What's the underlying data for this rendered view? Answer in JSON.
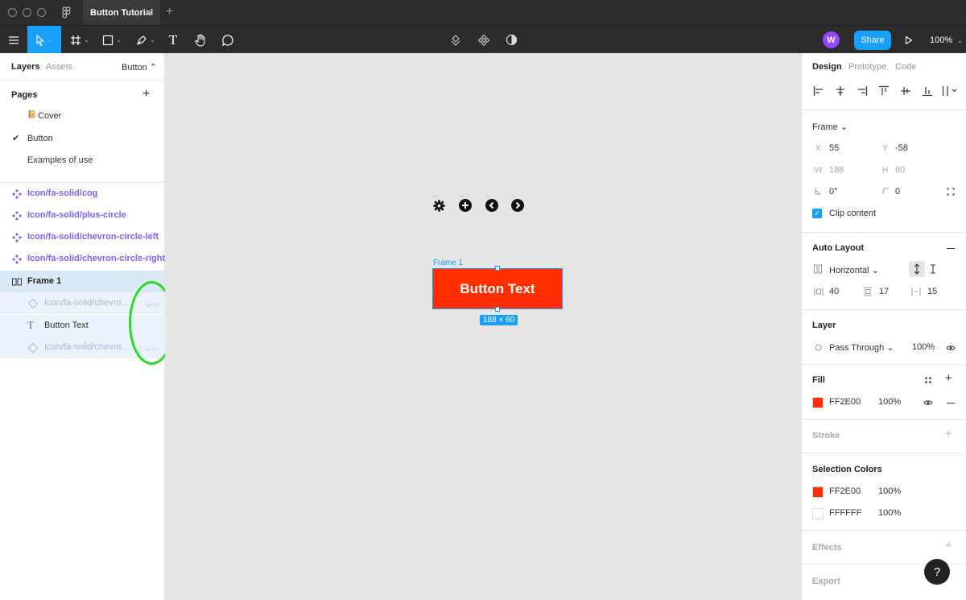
{
  "titlebar": {
    "tab_title": "Button Tutorial",
    "tab_close": "✕",
    "tab_add": "+"
  },
  "toolbar": {
    "share_label": "Share",
    "zoom_label": "100%",
    "avatar_initial": "W",
    "text_tool_glyph": "T"
  },
  "left_panel": {
    "tabs": {
      "layers": "Layers",
      "assets": "Assets",
      "page_dropdown": "Button ⌃"
    },
    "pages_title": "Pages",
    "pages_add": "+",
    "pages": [
      {
        "label": "Cover",
        "icon": "📔"
      },
      {
        "label": "Button",
        "check": "✔"
      },
      {
        "label": "Examples of use"
      }
    ],
    "layers": [
      {
        "label": "Icon/fa-solid/cog"
      },
      {
        "label": "Icon/fa-solid/plus-circle"
      },
      {
        "label": "Icon/fa-solid/chevron-circle-left"
      },
      {
        "label": "Icon/fa-solid/chevron-circle-right"
      },
      {
        "label": "Frame 1"
      },
      {
        "label": "Icon/fa-solid/chevro..."
      },
      {
        "label": "Button Text"
      },
      {
        "label": "Icon/fa-solid/chevro..."
      }
    ],
    "hidden_glyph": "◡◡"
  },
  "canvas": {
    "frame_label": "Frame 1",
    "button_text": "Button Text",
    "dimensions": "188 × 60",
    "component_dots": "⋯"
  },
  "right_panel": {
    "tabs": {
      "design": "Design",
      "prototype": "Prototype",
      "code": "Code"
    },
    "frame": {
      "title": "Frame ⌄",
      "x_label": "X",
      "x": "55",
      "y_label": "Y",
      "y": "-58",
      "w_label": "W",
      "w": "188",
      "h_label": "H",
      "h": "60",
      "rotation": "0°",
      "radius": "0",
      "clip_content": "Clip content"
    },
    "auto_layout": {
      "title": "Auto Layout",
      "direction": "Horizontal ⌄",
      "spacing": "40",
      "padding_v": "17",
      "padding_h": "15"
    },
    "layer": {
      "title": "Layer",
      "blend": "Pass Through ⌄",
      "opacity": "100%"
    },
    "fill": {
      "title": "Fill",
      "color_hex": "FF2E00",
      "opacity": "100%",
      "swatch": "#ff2e00"
    },
    "stroke": {
      "title": "Stroke"
    },
    "selection_colors": {
      "title": "Selection Colors",
      "items": [
        {
          "hex": "FF2E00",
          "opacity": "100%",
          "swatch": "#ff2e00"
        },
        {
          "hex": "FFFFFF",
          "opacity": "100%",
          "swatch": "#ffffff"
        }
      ]
    },
    "effects": {
      "title": "Effects"
    },
    "export": {
      "title": "Export"
    }
  },
  "help_label": "?",
  "colors": {
    "accent": "#18a0fb",
    "component": "#7b61ff",
    "highlight": "#22dd22",
    "dark_bar": "#2c2c2c"
  }
}
